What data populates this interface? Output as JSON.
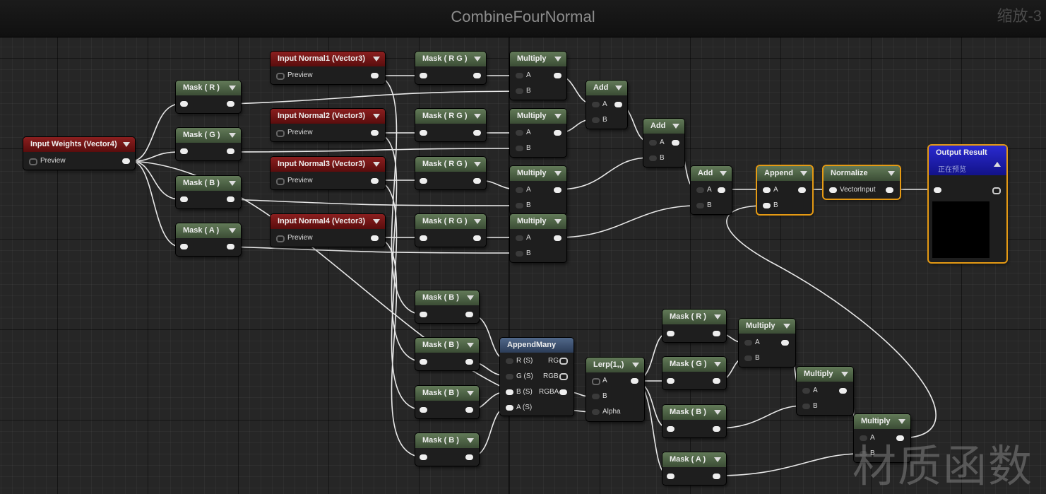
{
  "editor": {
    "title": "CombineFourNormal",
    "zoom_label": "缩放-3",
    "watermark": "材质函数"
  },
  "nodes": {
    "input_weights": {
      "title": "Input Weights (Vector4)",
      "out_label": "Preview"
    },
    "input_normal1": {
      "title": "Input Normal1 (Vector3)",
      "out_label": "Preview"
    },
    "input_normal2": {
      "title": "Input Normal2 (Vector3)",
      "out_label": "Preview"
    },
    "input_normal3": {
      "title": "Input Normal3 (Vector3)",
      "out_label": "Preview"
    },
    "input_normal4": {
      "title": "Input Normal4 (Vector3)",
      "out_label": "Preview"
    },
    "mask_r": {
      "title": "Mask ( R )"
    },
    "mask_g": {
      "title": "Mask ( G )"
    },
    "mask_b": {
      "title": "Mask ( B )"
    },
    "mask_a": {
      "title": "Mask ( A )"
    },
    "mask_rg_1": {
      "title": "Mask ( R G )"
    },
    "mask_rg_2": {
      "title": "Mask ( R G )"
    },
    "mask_rg_3": {
      "title": "Mask ( R G )"
    },
    "mask_rg_4": {
      "title": "Mask ( R G )"
    },
    "multiply_1": {
      "title": "Multiply",
      "in_a": "A",
      "in_b": "B"
    },
    "multiply_2": {
      "title": "Multiply",
      "in_a": "A",
      "in_b": "B"
    },
    "multiply_3": {
      "title": "Multiply",
      "in_a": "A",
      "in_b": "B"
    },
    "multiply_4": {
      "title": "Multiply",
      "in_a": "A",
      "in_b": "B"
    },
    "add_1": {
      "title": "Add",
      "in_a": "A",
      "in_b": "B"
    },
    "add_2": {
      "title": "Add",
      "in_a": "A",
      "in_b": "B"
    },
    "add_3": {
      "title": "Add",
      "in_a": "A",
      "in_b": "B"
    },
    "append": {
      "title": "Append",
      "in_a": "A",
      "in_b": "B"
    },
    "normalize": {
      "title": "Normalize",
      "in": "VectorInput"
    },
    "output_result": {
      "title": "Output Result",
      "subtitle": "正在预览"
    },
    "mask_b_1": {
      "title": "Mask ( B )"
    },
    "mask_b_2": {
      "title": "Mask ( B )"
    },
    "mask_b_3": {
      "title": "Mask ( B )"
    },
    "mask_b_4": {
      "title": "Mask ( B )"
    },
    "append_many": {
      "title": "AppendMany",
      "in_r": "R (S)",
      "in_g": "G (S)",
      "in_b": "B (S)",
      "in_a": "A (S)",
      "out_rg": "RG",
      "out_rgb": "RGB",
      "out_rgba": "RGBA"
    },
    "lerp": {
      "title": "Lerp(1,,)",
      "in_a": "A",
      "in_b": "B",
      "in_alpha": "Alpha"
    },
    "mask_r_2": {
      "title": "Mask ( R )"
    },
    "mask_g_2": {
      "title": "Mask ( G )"
    },
    "mask_b_5": {
      "title": "Mask ( B )"
    },
    "mask_a_2": {
      "title": "Mask ( A )"
    },
    "multiply_5": {
      "title": "Multiply",
      "in_a": "A",
      "in_b": "B"
    },
    "multiply_6": {
      "title": "Multiply",
      "in_a": "A",
      "in_b": "B"
    },
    "multiply_7": {
      "title": "Multiply",
      "in_a": "A",
      "in_b": "B"
    }
  }
}
